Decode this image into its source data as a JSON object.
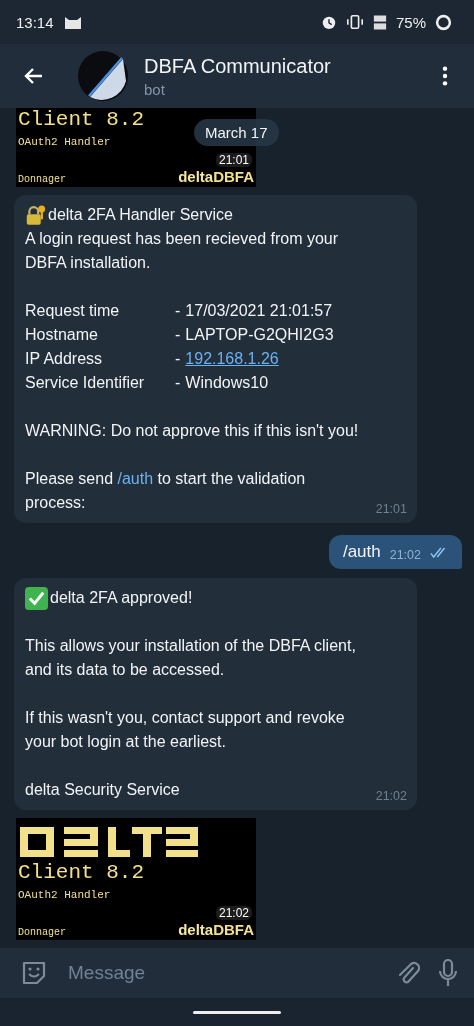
{
  "status_bar": {
    "time": "13:14",
    "battery": "75%"
  },
  "header": {
    "title": "DBFA Communicator",
    "subtitle": "bot"
  },
  "date_chip": "March 17",
  "messages": [
    {
      "kind": "image",
      "cut_top": true,
      "lines": [
        "Client 8.2",
        "OAuth2 Handler"
      ],
      "author": "Donnager",
      "brand_a": "delta",
      "brand_b": "DBFA",
      "time": "21:01"
    },
    {
      "kind": "request",
      "title": "delta 2FA Handler Service",
      "intro": "A login request has been recieved from your DBFA installation.",
      "fields": [
        {
          "label": "Request time",
          "dash": "-",
          "value": "17/03/2021 21:01:57",
          "link": false
        },
        {
          "label": "Hostname",
          "dash": "-",
          "value": "LAPTOP-G2QHI2G3",
          "link": false
        },
        {
          "label": "IP Address",
          "dash": "-",
          "value": "192.168.1.26",
          "link": true
        },
        {
          "label": "Service Identifier",
          "dash": "-",
          "value": "Windows10",
          "link": false
        }
      ],
      "warning": "WARNING:  Do not approve this if this isn't you!",
      "footer_before": "Please send",
      "command": "/auth",
      "footer_after": "to start the validation process:",
      "time": "21:01"
    },
    {
      "kind": "outgoing",
      "text": "/auth",
      "time": "21:02",
      "read": true
    },
    {
      "kind": "approved",
      "title": "delta 2FA approved!",
      "paragraphs": [
        "This allows your installation of the DBFA client, and its data to be accessed.",
        "If this wasn't you, contact support and revoke your bot login at the earliest.",
        "delta Security Service"
      ],
      "time": "21:02"
    },
    {
      "kind": "image",
      "cut_top": false,
      "lines": [
        "Client 8.2",
        "OAuth2 Handler"
      ],
      "author": "Donnager",
      "brand_a": "delta",
      "brand_b": "DBFA",
      "time": "21:02"
    }
  ],
  "composer": {
    "placeholder": "Message"
  }
}
